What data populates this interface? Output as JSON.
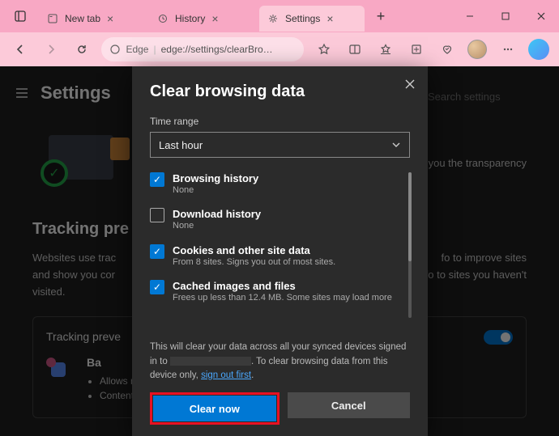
{
  "tabs": [
    {
      "label": "New tab"
    },
    {
      "label": "History"
    },
    {
      "label": "Settings"
    }
  ],
  "addressbar": {
    "prefix": "Edge",
    "url": "edge://settings/clearBro…"
  },
  "settings": {
    "title": "Settings",
    "search_placeholder": "Search settings"
  },
  "bg": {
    "tracking_heading": "Tracking pre",
    "tracking_para_left": "Websites use trac",
    "tracking_para_left2": "and show you cor",
    "tracking_para_left3": "visited.",
    "tracking_para_right": "g you the transparency",
    "tracking_para_right2": "fo to improve sites",
    "tracking_para_right3": "fo to sites you haven't",
    "card_heading": "Tracking preve",
    "card_title": "Ba",
    "card_b1": "Allows mos",
    "card_b2": "Content and"
  },
  "dialog": {
    "title": "Clear browsing data",
    "time_range_label": "Time range",
    "time_range_value": "Last hour",
    "options": [
      {
        "checked": true,
        "title": "Browsing history",
        "sub": "None"
      },
      {
        "checked": false,
        "title": "Download history",
        "sub": "None"
      },
      {
        "checked": true,
        "title": "Cookies and other site data",
        "sub": "From 8 sites. Signs you out of most sites."
      },
      {
        "checked": true,
        "title": "Cached images and files",
        "sub": "Frees up less than 12.4 MB. Some sites may load more"
      }
    ],
    "disclaimer_1": "This will clear your data across all your synced devices signed in to ",
    "disclaimer_2": ". To clear browsing data from this device only, ",
    "signout": "sign out first",
    "period": ".",
    "clear_btn": "Clear now",
    "cancel_btn": "Cancel"
  }
}
